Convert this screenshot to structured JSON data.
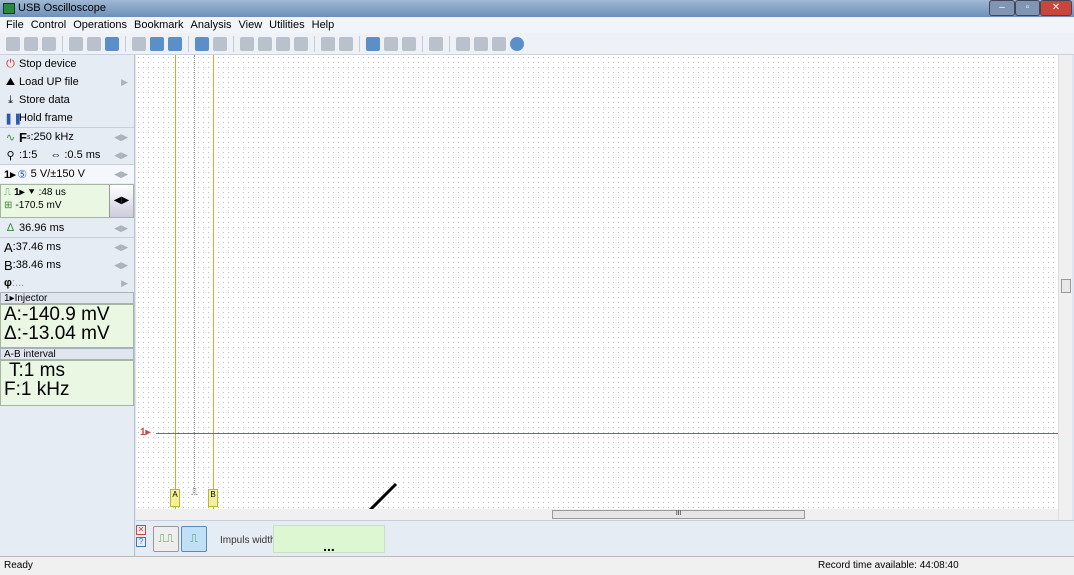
{
  "window": {
    "title": "USB Oscilloscope"
  },
  "menu": [
    "File",
    "Control",
    "Operations",
    "Bookmark",
    "Analysis",
    "View",
    "Utilities",
    "Help"
  ],
  "left": {
    "stop": "Stop device",
    "load": "Load UP file",
    "store": "Store data",
    "hold": "Hold frame",
    "fs": "F",
    "fs_sub": "s",
    "fs_val": ":250 kHz",
    "zoom": ":1:5",
    "timebase": ":0.5 ms",
    "channel": "1▸",
    "range": "5 V/±150 V",
    "trig_ch": "1▸",
    "trig_time": ":48 us",
    "trig_level": "-170.5 mV",
    "delta_t": "36.96 ms",
    "a_label": "A",
    "a_val": ":37.46 ms",
    "b_label": "B",
    "b_val": ":38.46 ms",
    "phi_label": "φ",
    "phi_val": ":...",
    "injector_header": "1▸Injector",
    "inj_a": "A:-140.9 mV",
    "inj_d": "Δ:-13.04 mV",
    "ab_header": "A-B interval",
    "ab_t": "T:1 ms",
    "ab_f": "F:1 kHz"
  },
  "plot": {
    "channel_marker": "1▸",
    "cursor_a": "A",
    "cursor_b": "B",
    "trace_color": "#c0504d",
    "cursor_color": "#b5b82a",
    "scroll_mark": "III"
  },
  "bottom": {
    "impulse_label": "Impuls width:",
    "impulse_value": "..."
  },
  "status": {
    "left": "Ready",
    "right": "Record time available: 44:08:40"
  }
}
